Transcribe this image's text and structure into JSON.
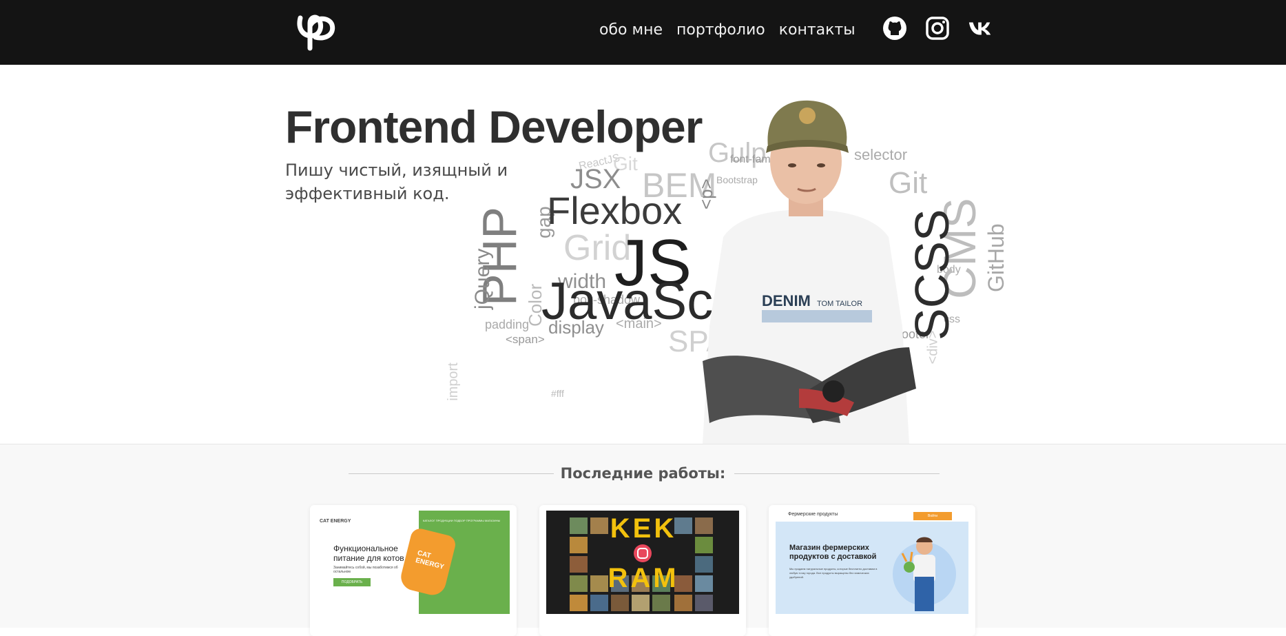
{
  "header": {
    "nav": [
      "обо мне",
      "портфолио",
      "контакты"
    ],
    "social": [
      "github-icon",
      "instagram-icon",
      "vk-icon"
    ]
  },
  "hero": {
    "title": "Frontend Developer",
    "subtitle": "Пишу чистый, изящный и эффективный код."
  },
  "cloud": {
    "words": [
      "JSX",
      "BEM",
      "Gulp",
      "Git",
      "Flexbox",
      "JS",
      "JavaScript",
      "PHP",
      "jQuery",
      "gap",
      "Grid",
      "width",
      "display",
      "padding",
      "box-shadow",
      "Color",
      "CMS",
      "SCSS",
      "GitHub",
      "SPA",
      "<span>",
      "<main>",
      "<div>",
      "<p>",
      "Bootstrap",
      "selector",
      "body",
      "footer",
      "css",
      "import",
      "font-family",
      "ReactJS",
      "#fff",
      "Git"
    ]
  },
  "works": {
    "title": "Последние работы:",
    "cards": [
      {
        "brand": "CAT ENERGY",
        "nav": "КАТАЛОГ ПРОДУКЦИИ  ПОДБОР ПРОГРАММЫ  МАГАЗИНЫ",
        "heading": "Функциональное питание для котов",
        "sub": "Занимайтесь собой, мы позаботимся об остальном",
        "button": "ПОДОБРАТЬ ПРОГРАММУ",
        "product": "CAT ENERGY"
      },
      {
        "brand": "KEKSOGRAM",
        "top": "KEK",
        "bottom": "RAM"
      },
      {
        "brand": "Фермерские продукты",
        "button": "Войти",
        "heading": "Магазин фермерских продуктов с доставкой",
        "body": "Мы продаем натуральные продукты, которые бесплатно доставим в любую точку города. Все продукты выращены без химических удобрений."
      }
    ]
  },
  "colors": {
    "header_bg": "#141414",
    "cat_green": "#6ab04c",
    "farm_orange": "#f39c2e",
    "farm_blue": "#d3e6f7"
  }
}
